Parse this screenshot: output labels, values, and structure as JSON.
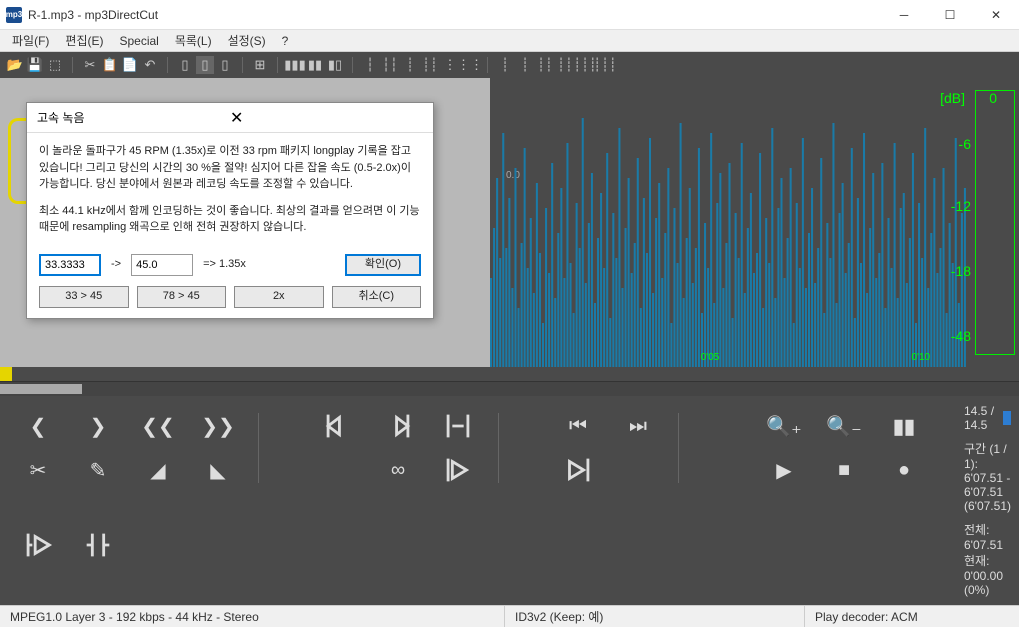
{
  "window": {
    "title": "R-1.mp3 - mp3DirectCut",
    "icon_text": "mp3"
  },
  "menu": {
    "file": "파일(F)",
    "edit": "편집(E)",
    "special": "Special",
    "list": "목록(L)",
    "settings": "설정(S)",
    "help": "?"
  },
  "waveform": {
    "zero_label": "0.0",
    "time1": "0'05",
    "time2": "0'10",
    "db_title": "[dB]",
    "db_ticks": [
      "0",
      "-6",
      "-12",
      "-18",
      "-48"
    ]
  },
  "info": {
    "pos": "14.5 / 14.5",
    "range": "구간 (1 / 1): 6'07.51 - 6'07.51 (6'07.51)",
    "total": "전체: 6'07.51   현재: 0'00.00 (0%)"
  },
  "status": {
    "format": "MPEG1.0 Layer 3 - 192 kbps - 44 kHz - Stereo",
    "id3": "ID3v2 (Keep: 예)",
    "decoder": "Play decoder: ACM"
  },
  "dialog": {
    "title": "고속 녹음",
    "para1": "이 놀라운 돌파구가 45 RPM (1.35x)로 이전 33 rpm 패키지 longplay 기록을 잡고 있습니다! 그리고 당신의 시간의 30 %을 절약! 심지어 다른 잡을 속도 (0.5-2.0x)이 가능합니다. 당신 분야에서 원본과 레코딩 속도를 조정할 수 있습니다.",
    "para2": "최소 44.1 kHz에서 함께 인코딩하는 것이 좋습니다. 최상의 결과를 얻으려면 이 기능 때문에 resampling 왜곡으로 인해 전혀 권장하지 않습니다.",
    "from_val": "33.3333",
    "arrow": "->",
    "to_val": "45.0",
    "result": "=> 1.35x",
    "ok": "확인(O)",
    "b33_45": "33 > 45",
    "b78_45": "78 > 45",
    "b2x": "2x",
    "cancel": "취소(C)"
  }
}
